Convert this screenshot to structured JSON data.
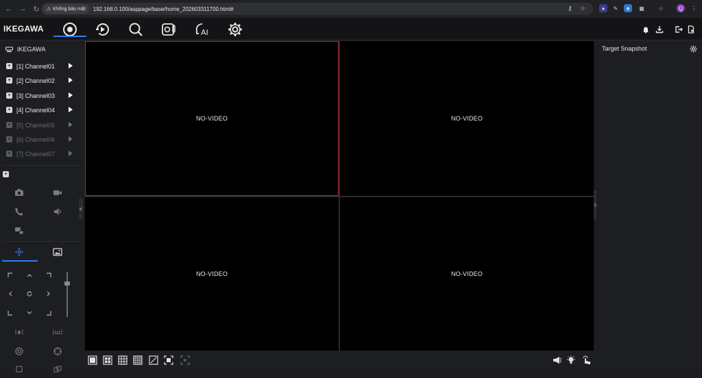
{
  "browser": {
    "security_label": "Không bảo mật",
    "url": "192.168.0.100/asppage/base/home_202603311700.html#"
  },
  "header": {
    "logo": "IKEGAWA",
    "nav": [
      {
        "name": "live-view",
        "icon": "live-view-icon",
        "active": true
      },
      {
        "name": "playback",
        "icon": "playback-icon"
      },
      {
        "name": "search",
        "icon": "search-icon"
      },
      {
        "name": "thermal",
        "icon": "thermal-camera-icon"
      },
      {
        "name": "ai",
        "icon": "ai-icon",
        "label": "AI"
      },
      {
        "name": "settings",
        "icon": "gear-icon"
      }
    ],
    "right_icons": [
      "bell-icon",
      "download-icon",
      "logout-icon",
      "file-icon"
    ],
    "accent": "#2d7ff3"
  },
  "device_tree": {
    "device_name": "IKEGAWA",
    "channels": [
      {
        "label": "[1] Channel01",
        "active": true
      },
      {
        "label": "[2] Channel02",
        "active": true
      },
      {
        "label": "[3] Channel03",
        "active": true
      },
      {
        "label": "[4] Channel04",
        "active": true
      },
      {
        "label": "[5] Channel05",
        "active": false
      },
      {
        "label": "[6] Channel06",
        "active": false
      },
      {
        "label": "[7] Channel07",
        "active": false
      }
    ]
  },
  "video": {
    "cells": [
      {
        "text": "NO-VIDEO",
        "selected": true
      },
      {
        "text": "NO-VIDEO",
        "selected": false
      },
      {
        "text": "NO-VIDEO",
        "selected": false
      },
      {
        "text": "NO-VIDEO",
        "selected": false
      }
    ],
    "selected_border": "#b5282f"
  },
  "right_panel": {
    "title": "Target Snapshot"
  },
  "ptz_tab_accent": "#2d7ff3"
}
